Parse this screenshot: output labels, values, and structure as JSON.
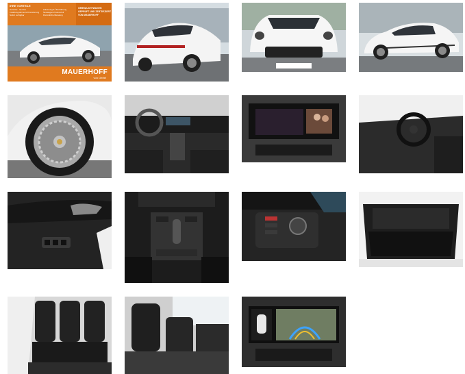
{
  "gallery": {
    "thumbnails": [
      {
        "subject": "front-three-quarter exterior with dealer banner",
        "banner": {
          "left_title": "IHRE VORTEILE",
          "left_lines": [
            "Garantie · Service",
            "Inzahlungnahme & Finanzierung",
            "Sofort verfügbar"
          ],
          "mid_lines": [
            "Zulassung & Überführung",
            "Neuwagen-Preisvorteil",
            "Persönliche Beratung"
          ],
          "right_lines": [
            "GEBRAUCHTWAGEN",
            "GEPRÜFT UND ZERTIFIZIERT",
            "VON MAUERHOFF"
          ],
          "brand": "MAUERHOFF",
          "brand_sub": "von Oertel"
        }
      },
      {
        "subject": "rear three-quarter exterior"
      },
      {
        "subject": "front view exterior"
      },
      {
        "subject": "side profile exterior"
      },
      {
        "subject": "wheel and tyre detail"
      },
      {
        "subject": "dashboard and cockpit overview"
      },
      {
        "subject": "infotainment screen"
      },
      {
        "subject": "steering wheel and driver seat"
      },
      {
        "subject": "door panel and window switches"
      },
      {
        "subject": "centre console and gear selector"
      },
      {
        "subject": "headlight switch and dashboard detail"
      },
      {
        "subject": "luggage compartment"
      },
      {
        "subject": "rear seats"
      },
      {
        "subject": "front seats"
      },
      {
        "subject": "reversing camera screen"
      }
    ]
  },
  "colors": {
    "accent": "#e07a1f",
    "body_white": "#f3f3f3",
    "interior_black": "#1b1b1b"
  }
}
